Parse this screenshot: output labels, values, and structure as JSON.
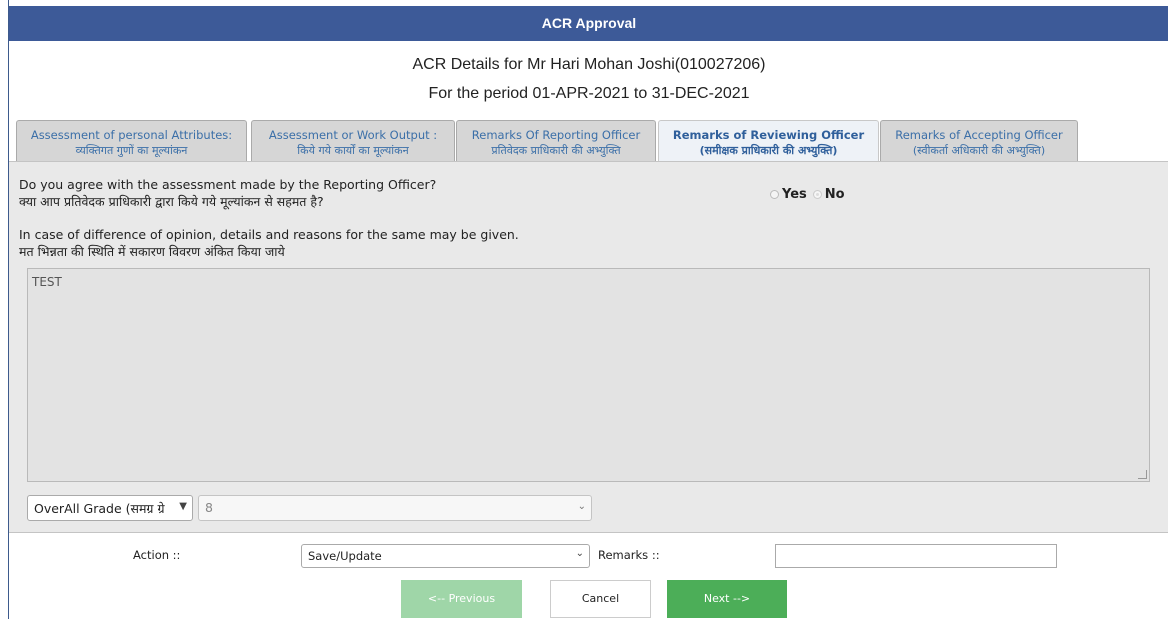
{
  "header": {
    "title": "ACR Approval"
  },
  "details": {
    "line1": "ACR Details for Mr Hari Mohan Joshi(010027206)",
    "line2": "For the period 01-APR-2021 to 31-DEC-2021"
  },
  "tabs": [
    {
      "line1": "Assessment of personal Attributes:",
      "line2": "व्यक्तिगत गुणों का मूल्यांकन",
      "active": false
    },
    {
      "line1": "Assessment or Work Output :",
      "line2": "किये गये कार्यों का मूल्यांकन",
      "active": false
    },
    {
      "line1": "Remarks Of Reporting Officer",
      "line2": "प्रतिवेदक प्राधिकारी की अभ्युक्ति",
      "active": false
    },
    {
      "line1": "Remarks of Reviewing Officer",
      "line2": "(समीक्षक प्राधिकारी की अभ्युक्ति)",
      "active": true
    },
    {
      "line1": "Remarks of Accepting Officer",
      "line2": "(स्वीकर्ता अधिकारी की अभ्युक्ति)",
      "active": false
    }
  ],
  "question": {
    "en": "Do you agree with the assessment made by the Reporting Officer?",
    "hi": "क्या आप प्रतिवेदक प्राधिकारी द्वारा किये गये मूल्यांकन से सहमत है?",
    "yes_label": "Yes",
    "no_label": "No",
    "selected": "No"
  },
  "difference": {
    "en": "In case of difference of opinion, details and reasons for the same may be given.",
    "hi": "मत भिन्नता की स्थिति में सकारण विवरण अंकित किया जाये",
    "value": "TEST"
  },
  "grade": {
    "label_select": "OverAll Grade (समग्र ग्रे",
    "value": "8"
  },
  "action": {
    "label": "Action ::",
    "selected": "Save/Update",
    "remarks_label": "Remarks ::",
    "remarks_value": ""
  },
  "buttons": {
    "previous": "<-- Previous",
    "cancel": "Cancel",
    "next": "Next -->"
  },
  "colors": {
    "header_bg": "#3d5a98",
    "tab_text": "#3b6fa8",
    "next_btn": "#4cae58",
    "prev_btn_disabled": "#9fd6a8"
  }
}
